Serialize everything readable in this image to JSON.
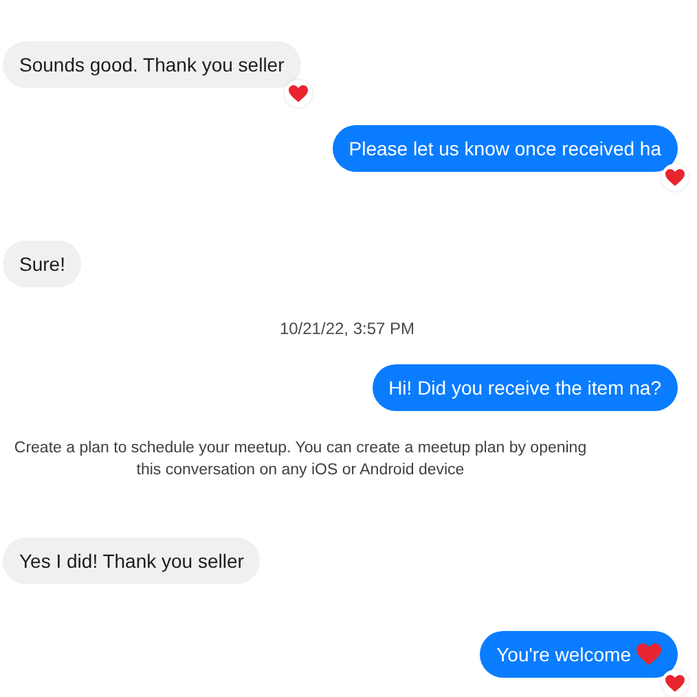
{
  "messages": [
    {
      "kind": "incoming",
      "text": "Sounds good. Thank you seller",
      "reacted": true
    },
    {
      "kind": "outgoing",
      "text": "Please let us know once received ha",
      "reacted": true
    },
    {
      "kind": "incoming",
      "text": "Sure!",
      "reacted": false
    },
    {
      "kind": "timestamp",
      "text": "10/21/22, 3:57 PM"
    },
    {
      "kind": "outgoing",
      "text": "Hi! Did you receive the item na?",
      "reacted": false
    },
    {
      "kind": "notice",
      "text": "Create a plan to schedule your meetup. You can create a meetup plan by opening this conversation on any iOS or Android device"
    },
    {
      "kind": "incoming",
      "text": "Yes I did! Thank you seller",
      "reacted": false
    },
    {
      "kind": "outgoing",
      "text": "You're welcome",
      "trailing_heart": true,
      "reacted": true
    }
  ]
}
